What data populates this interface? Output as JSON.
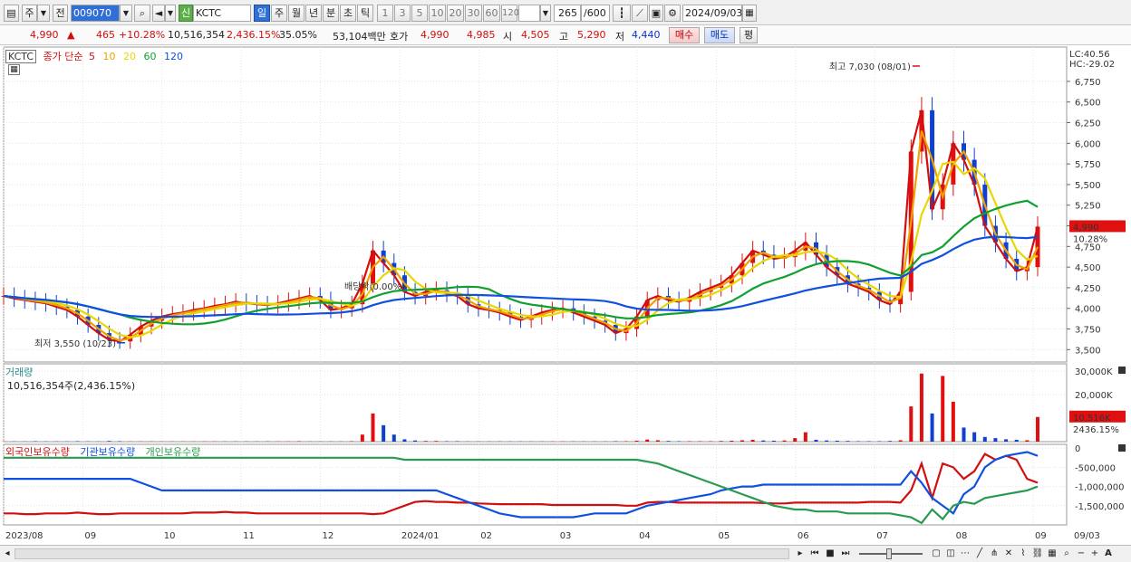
{
  "toolbar": {
    "period_type": "주",
    "prev_label": "전",
    "stock_code": "009070",
    "credit_badge": "신",
    "stock_name": "KCTC",
    "interval_tabs": [
      "일",
      "주",
      "월",
      "년",
      "분",
      "초",
      "틱"
    ],
    "minute_options": [
      "1",
      "3",
      "5",
      "10",
      "20",
      "30",
      "60",
      "120"
    ],
    "count_value": "265",
    "count_total": "/600",
    "date_value": "2024/09/03"
  },
  "quote": {
    "price": "4,990",
    "arrow": "▲",
    "change": "465",
    "change_pct": "+10.28%",
    "volume": "10,516,354",
    "volume_ratio": "2,436.15%",
    "turnover": "35.05%",
    "amount": "53,104백만",
    "bid_label": "호가",
    "ask": "4,990",
    "bid": "4,985",
    "open_label": "시",
    "open": "4,505",
    "high_label": "고",
    "high": "5,290",
    "low_label": "저",
    "low": "4,440",
    "buy_button": "매수",
    "sell_button": "매도",
    "eval_button": "평"
  },
  "legend": {
    "name": "KCTC",
    "ma_prefix": "종가 단순",
    "ma_periods": [
      "5",
      "10",
      "20",
      "60",
      "120"
    ],
    "ma_colors": [
      "#d01010",
      "#f0a000",
      "#e8d800",
      "#10a030",
      "#1050e0"
    ],
    "volume_title": "거래량",
    "volume_value": "10,516,354주(2,436.15%)",
    "holdings": [
      "외국인보유수량",
      "기관보유수량",
      "개인보유수량"
    ],
    "holdings_colors": [
      "#d01010",
      "#1050e0",
      "#2a9a50"
    ]
  },
  "chart_data": {
    "type": "candlestick",
    "price_axis": {
      "ticks": [
        "6,750",
        "6,500",
        "6,250",
        "6,000",
        "5,750",
        "5,500",
        "5,250",
        "5,000",
        "4,750",
        "4,500",
        "4,250",
        "4,000",
        "3,750",
        "3,500"
      ],
      "lc": "LC:40.56",
      "hc": "HC:-29.02",
      "current_price": "4,990",
      "current_pct": "10.28%"
    },
    "volume_axis": {
      "ticks": [
        "30,000K",
        "20,000K"
      ],
      "current": "10,516K",
      "current_pct": "2436.15%"
    },
    "holdings_axis": {
      "ticks": [
        "0",
        "-500,000",
        "-1,000,000",
        "-1,500,000"
      ]
    },
    "x_labels": [
      "2023/08",
      "09",
      "10",
      "11",
      "12",
      "2024/01",
      "02",
      "03",
      "04",
      "05",
      "06",
      "07",
      "08",
      "09",
      "09/03"
    ],
    "annotations": {
      "high": "최고 7,030 (08/01)",
      "low": "최저 3,550 (10/23)",
      "dividend": "배당락(0.00%)"
    },
    "price_range": [
      3350,
      7100
    ],
    "close_series": [
      4150,
      4120,
      4100,
      4080,
      4060,
      4020,
      3980,
      3900,
      3800,
      3700,
      3620,
      3600,
      3680,
      3780,
      3850,
      3900,
      3930,
      3950,
      3980,
      4000,
      4030,
      4050,
      4080,
      4060,
      4050,
      4040,
      4060,
      4090,
      4120,
      4150,
      4100,
      3980,
      4000,
      4050,
      4300,
      4700,
      4550,
      4400,
      4200,
      4150,
      4200,
      4220,
      4180,
      4150,
      4050,
      4000,
      3980,
      3950,
      3900,
      3860,
      3900,
      3950,
      3980,
      4000,
      3950,
      3900,
      3850,
      3800,
      3700,
      3750,
      3900,
      4100,
      4150,
      4100,
      4080,
      4130,
      4200,
      4250,
      4300,
      4400,
      4550,
      4700,
      4650,
      4600,
      4620,
      4700,
      4800,
      4650,
      4500,
      4400,
      4300,
      4250,
      4200,
      4100,
      4050,
      4200,
      5900,
      6400,
      5200,
      5500,
      6000,
      5800,
      5500,
      5000,
      4800,
      4600,
      4450,
      4500,
      4990
    ],
    "volume_series": [
      0.1,
      0.1,
      0.1,
      0.2,
      0.1,
      0.1,
      0.1,
      0.2,
      0.1,
      0.1,
      0.3,
      0.2,
      0.1,
      0.1,
      0.1,
      0.1,
      0.1,
      0.1,
      0.1,
      0.1,
      0.1,
      0.1,
      0.1,
      0.1,
      0.1,
      0.1,
      0.1,
      0.1,
      0.2,
      0.1,
      0.1,
      0.1,
      0.1,
      0.2,
      3.0,
      12.0,
      7.0,
      3.0,
      1.0,
      0.5,
      0.3,
      0.3,
      0.2,
      0.2,
      0.1,
      0.1,
      0.1,
      0.1,
      0.1,
      0.1,
      0.1,
      0.1,
      0.1,
      0.1,
      0.1,
      0.1,
      0.1,
      0.1,
      0.2,
      0.2,
      0.4,
      0.9,
      0.6,
      0.3,
      0.2,
      0.2,
      0.2,
      0.2,
      0.3,
      0.4,
      0.6,
      0.8,
      0.5,
      0.4,
      0.5,
      1.5,
      4.0,
      0.8,
      0.5,
      0.4,
      0.3,
      0.2,
      0.2,
      0.2,
      0.3,
      0.6,
      15.0,
      29.0,
      12.0,
      28.0,
      17.0,
      6.0,
      4.0,
      2.0,
      1.5,
      1.0,
      0.8,
      0.6,
      10.5
    ],
    "holdings_series": {
      "foreign": [
        -1700000,
        -1700000,
        -1720000,
        -1720000,
        -1700000,
        -1700000,
        -1700000,
        -1680000,
        -1700000,
        -1720000,
        -1720000,
        -1700000,
        -1700000,
        -1700000,
        -1700000,
        -1700000,
        -1700000,
        -1700000,
        -1680000,
        -1680000,
        -1680000,
        -1660000,
        -1680000,
        -1680000,
        -1700000,
        -1700000,
        -1700000,
        -1700000,
        -1700000,
        -1700000,
        -1700000,
        -1700000,
        -1700000,
        -1700000,
        -1700000,
        -1720000,
        -1700000,
        -1600000,
        -1500000,
        -1400000,
        -1380000,
        -1400000,
        -1400000,
        -1420000,
        -1420000,
        -1440000,
        -1450000,
        -1460000,
        -1460000,
        -1460000,
        -1460000,
        -1460000,
        -1480000,
        -1480000,
        -1480000,
        -1480000,
        -1480000,
        -1480000,
        -1480000,
        -1500000,
        -1500000,
        -1420000,
        -1400000,
        -1400000,
        -1420000,
        -1420000,
        -1420000,
        -1420000,
        -1420000,
        -1420000,
        -1420000,
        -1420000,
        -1430000,
        -1440000,
        -1440000,
        -1420000,
        -1420000,
        -1420000,
        -1420000,
        -1420000,
        -1420000,
        -1420000,
        -1400000,
        -1400000,
        -1400000,
        -1420000,
        -1100000,
        -400000,
        -1300000,
        -400000,
        -500000,
        -800000,
        -600000,
        -150000,
        -300000,
        -200000,
        -300000,
        -800000,
        -900000
      ],
      "institution": [
        -800000,
        -800000,
        -800000,
        -800000,
        -800000,
        -800000,
        -800000,
        -800000,
        -800000,
        -800000,
        -800000,
        -800000,
        -800000,
        -900000,
        -1000000,
        -1100000,
        -1100000,
        -1100000,
        -1100000,
        -1100000,
        -1100000,
        -1100000,
        -1100000,
        -1100000,
        -1100000,
        -1100000,
        -1100000,
        -1100000,
        -1100000,
        -1100000,
        -1100000,
        -1100000,
        -1100000,
        -1100000,
        -1100000,
        -1100000,
        -1100000,
        -1100000,
        -1100000,
        -1100000,
        -1100000,
        -1100000,
        -1200000,
        -1300000,
        -1400000,
        -1500000,
        -1600000,
        -1700000,
        -1750000,
        -1800000,
        -1800000,
        -1800000,
        -1800000,
        -1800000,
        -1800000,
        -1750000,
        -1700000,
        -1700000,
        -1700000,
        -1700000,
        -1600000,
        -1500000,
        -1450000,
        -1400000,
        -1350000,
        -1300000,
        -1250000,
        -1200000,
        -1100000,
        -1050000,
        -1000000,
        -1000000,
        -950000,
        -950000,
        -950000,
        -950000,
        -950000,
        -950000,
        -950000,
        -950000,
        -950000,
        -950000,
        -950000,
        -950000,
        -950000,
        -950000,
        -600000,
        -900000,
        -1300000,
        -1500000,
        -1700000,
        -1200000,
        -1000000,
        -500000,
        -300000,
        -200000,
        -150000,
        -100000,
        -200000
      ],
      "individual": [
        -250000,
        -250000,
        -250000,
        -250000,
        -250000,
        -250000,
        -250000,
        -250000,
        -250000,
        -250000,
        -250000,
        -250000,
        -250000,
        -250000,
        -250000,
        -250000,
        -250000,
        -250000,
        -250000,
        -250000,
        -250000,
        -250000,
        -250000,
        -250000,
        -250000,
        -250000,
        -250000,
        -250000,
        -250000,
        -250000,
        -250000,
        -250000,
        -250000,
        -250000,
        -250000,
        -250000,
        -250000,
        -250000,
        -300000,
        -300000,
        -300000,
        -300000,
        -300000,
        -300000,
        -300000,
        -300000,
        -300000,
        -300000,
        -300000,
        -300000,
        -300000,
        -300000,
        -300000,
        -300000,
        -300000,
        -300000,
        -300000,
        -300000,
        -300000,
        -300000,
        -300000,
        -350000,
        -400000,
        -500000,
        -600000,
        -700000,
        -800000,
        -900000,
        -1000000,
        -1100000,
        -1200000,
        -1300000,
        -1400000,
        -1500000,
        -1550000,
        -1600000,
        -1600000,
        -1650000,
        -1650000,
        -1650000,
        -1700000,
        -1700000,
        -1700000,
        -1700000,
        -1700000,
        -1750000,
        -1800000,
        -1950000,
        -1600000,
        -1850000,
        -1500000,
        -1400000,
        -1450000,
        -1300000,
        -1250000,
        -1200000,
        -1150000,
        -1100000,
        -1000000
      ]
    }
  },
  "bottom": {
    "zoom_out": "−",
    "zoom_in": "+",
    "font": "A"
  }
}
